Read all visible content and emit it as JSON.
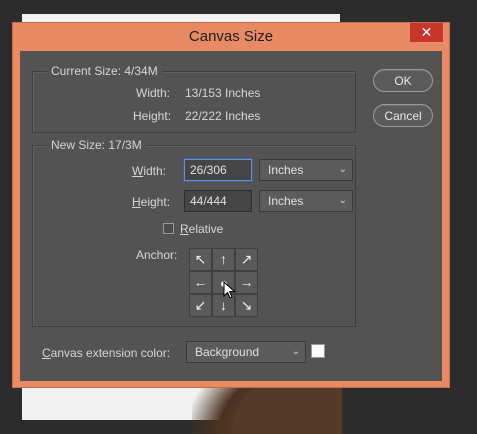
{
  "dialog": {
    "title": "Canvas Size",
    "close_glyph": "✕"
  },
  "current_size": {
    "legend": "Current Size: 4/34M",
    "width_label": "Width:",
    "width_value": "13/153 Inches",
    "height_label": "Height:",
    "height_value": "22/222 Inches"
  },
  "new_size": {
    "legend": "New Size: 17/3M",
    "width_label_u": "W",
    "width_label_rest": "idth:",
    "width_value": "26/306",
    "width_unit": "Inches",
    "height_label_u": "H",
    "height_label_rest": "eight:",
    "height_value": "44/444",
    "height_unit": "Inches",
    "relative_u": "R",
    "relative_rest": "elative",
    "relative_checked": false,
    "anchor_label": "Anchor:",
    "anchor_arrows": [
      "↖",
      "↑",
      "↗",
      "←",
      "",
      "→",
      "↙",
      "↓",
      "↘"
    ]
  },
  "buttons": {
    "ok": "OK",
    "cancel": "Cancel"
  },
  "extension": {
    "label_u": "C",
    "label_rest": "anvas extension color:",
    "value": "Background",
    "swatch_color": "#ffffff"
  },
  "icons": {
    "close": "close-icon",
    "dropdown": "chevron-down-icon",
    "cursor": "arrow-cursor-icon"
  }
}
